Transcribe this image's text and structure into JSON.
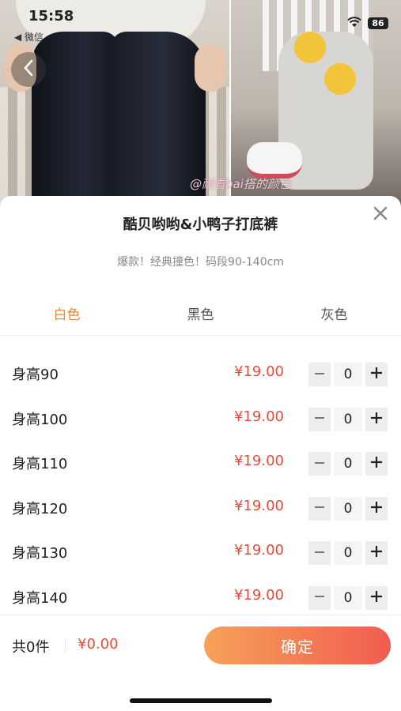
{
  "status_bar": {
    "time": "15:58",
    "back_app": "◀ 微信",
    "battery": "86"
  },
  "photo": {
    "watermark": "@耐看bai搭的颜色"
  },
  "sheet": {
    "title": "酷贝哟哟&小鸭子打底裤",
    "subtitle": "爆款！经典撞色！码段90-140cm",
    "tabs": [
      {
        "label": "白色",
        "active": true
      },
      {
        "label": "黑色",
        "active": false
      },
      {
        "label": "灰色",
        "active": false
      }
    ],
    "sizes": [
      {
        "label": "身高90",
        "price": "¥19.00",
        "qty": "0"
      },
      {
        "label": "身高100",
        "price": "¥19.00",
        "qty": "0"
      },
      {
        "label": "身高110",
        "price": "¥19.00",
        "qty": "0"
      },
      {
        "label": "身高120",
        "price": "¥19.00",
        "qty": "0"
      },
      {
        "label": "身高130",
        "price": "¥19.00",
        "qty": "0"
      },
      {
        "label": "身高140",
        "price": "¥19.00",
        "qty": "0"
      }
    ]
  },
  "footer": {
    "count": "共0件",
    "total": "¥0.00",
    "confirm_label": "确定"
  },
  "colors": {
    "accent_orange": "#f0873a",
    "price_red": "#e74c3c",
    "button_gradient_start": "#f6a25a",
    "button_gradient_end": "#f15c50"
  }
}
